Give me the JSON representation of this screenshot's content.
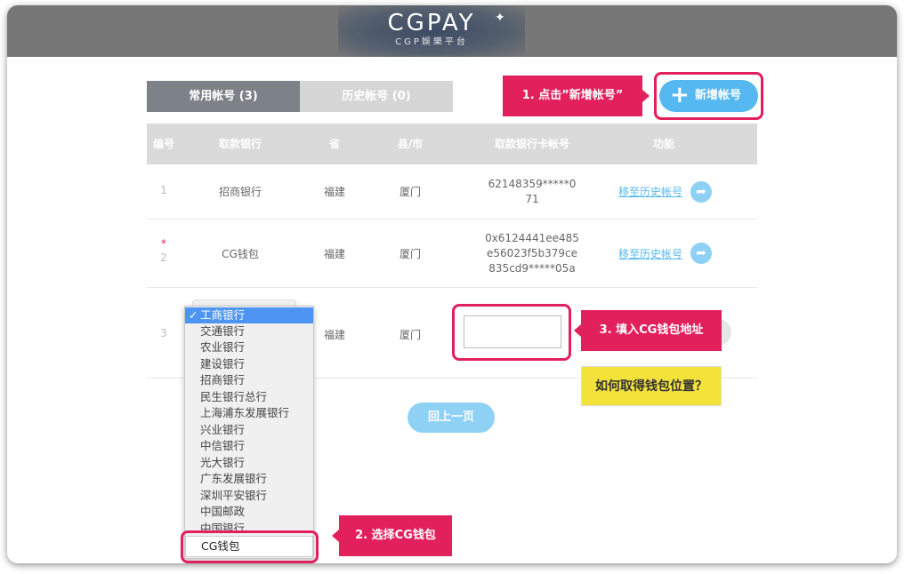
{
  "header": {
    "logo_main": "CGPAY",
    "logo_sub": "CGP娛樂平台"
  },
  "tabs": [
    {
      "label": "常用帐号 (3)",
      "active": true
    },
    {
      "label": "历史帐号 (0)",
      "active": false
    }
  ],
  "add_button": {
    "icon": "+",
    "label": "新增帐号"
  },
  "callouts": {
    "step1": "1. 点击”新增帐号”",
    "step2": "2. 选择CG钱包",
    "step3": "3. 填入CG钱包地址"
  },
  "table": {
    "headers": [
      "编号",
      "取款银行",
      "省",
      "县/市",
      "取款银行卡帐号",
      "功能"
    ],
    "rows": [
      {
        "index": "1",
        "required": "",
        "bank": "招商银行",
        "province": "福建",
        "city": "厦门",
        "account_lines": [
          "62148359*****0",
          "71"
        ],
        "action": "移至历史帐号"
      },
      {
        "index": "2",
        "required": "*",
        "bank": "CG钱包",
        "province": "福建",
        "city": "厦门",
        "account_lines": [
          "0x6124441ee485",
          "e56023f5b379ce",
          "835cd9*****05a"
        ],
        "action": "移至历史帐号"
      },
      {
        "index": "3",
        "province": "福建",
        "city": "厦门"
      }
    ]
  },
  "dropdown": {
    "options": [
      "工商银行",
      "交通银行",
      "农业银行",
      "建设银行",
      "招商银行",
      "民生银行总行",
      "上海浦东发展银行",
      "兴业银行",
      "中信银行",
      "光大银行",
      "广东发展银行",
      "深圳平安银行",
      "中国邮政",
      "中国银行"
    ],
    "selected_index": 0,
    "highlighted_option": "CG钱包"
  },
  "help_button": "如何取得钱包位置？",
  "back_button": "回上一页",
  "colors": {
    "accent_pink": "#e2205c",
    "button_blue": "#55b8f0",
    "help_yellow": "#f2e23a",
    "header_gray": "#777777"
  }
}
